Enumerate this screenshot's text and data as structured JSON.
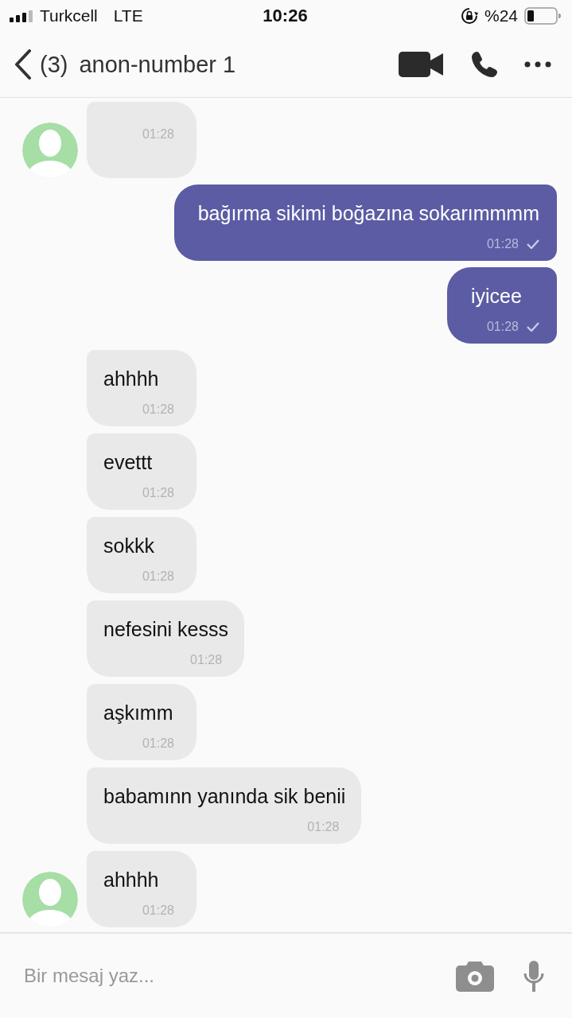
{
  "status_bar": {
    "carrier": "Turkcell",
    "network": "LTE",
    "time": "10:26",
    "battery": "%24"
  },
  "header": {
    "unread_count": "(3)",
    "title": "anon-number 1"
  },
  "messages": [
    {
      "kind": "incoming",
      "time": "01:28",
      "avatar": true
    },
    {
      "kind": "outgoing",
      "text": "bağırma sikimi boğazına sokarımmmm",
      "time": "01:28",
      "delivered": true
    },
    {
      "kind": "outgoing",
      "text": "iyicee",
      "time": "01:28",
      "delivered": true
    },
    {
      "kind": "incoming",
      "text": "ahhhh",
      "time": "01:28",
      "avatar": false
    },
    {
      "kind": "incoming",
      "text": "evettt",
      "time": "01:28",
      "avatar": false
    },
    {
      "kind": "incoming",
      "text": "sokkk",
      "time": "01:28",
      "avatar": false
    },
    {
      "kind": "incoming",
      "text": "nefesini kesss",
      "time": "01:28",
      "avatar": false
    },
    {
      "kind": "incoming",
      "text": "aşkımm",
      "time": "01:28",
      "avatar": false
    },
    {
      "kind": "incoming",
      "text": "babamınn yanında sik benii",
      "time": "01:28",
      "avatar": false
    },
    {
      "kind": "incoming",
      "text": "ahhhh",
      "time": "01:28",
      "avatar": true
    }
  ],
  "composer": {
    "placeholder": "Bir mesaj yaz..."
  }
}
